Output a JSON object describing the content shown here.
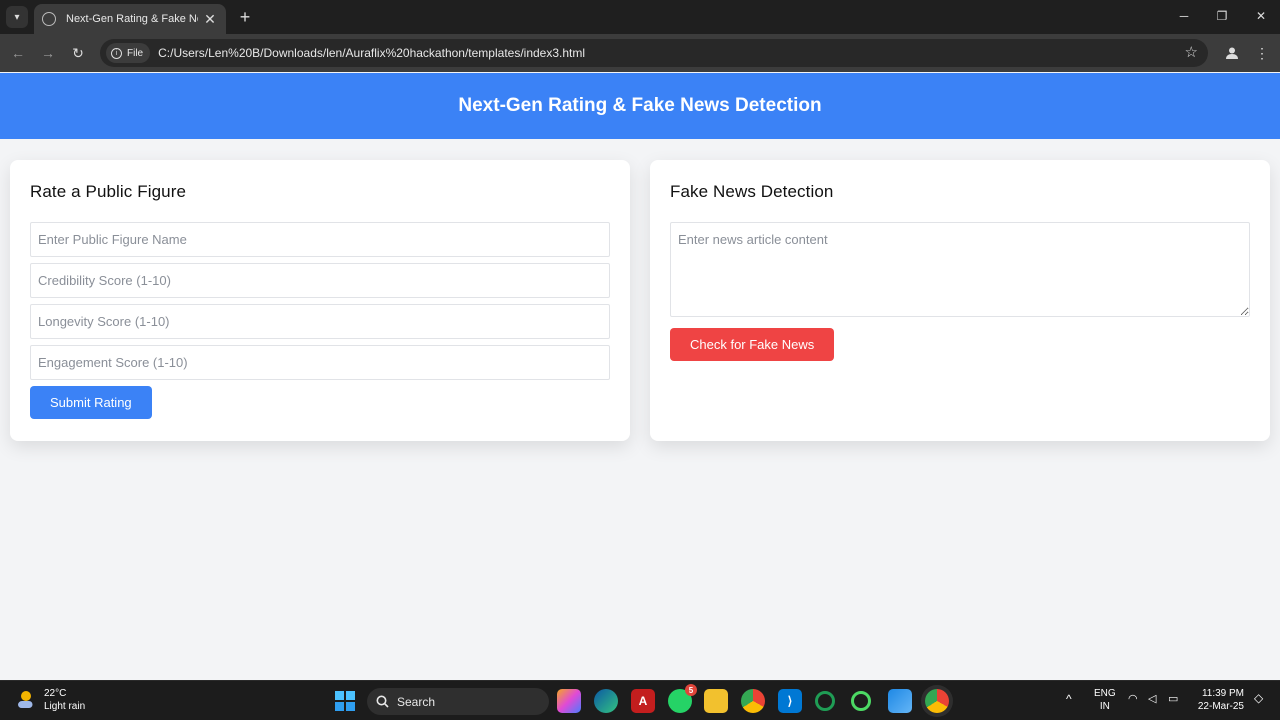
{
  "browser": {
    "tab_title": "Next-Gen Rating & Fake News Detection",
    "chip_label": "File",
    "url": "C:/Users/Len%20B/Downloads/len/Auraflix%20hackathon/templates/index3.html"
  },
  "header": {
    "title": "Next-Gen Rating & Fake News Detection"
  },
  "rating": {
    "heading": "Rate a Public Figure",
    "name_placeholder": "Enter Public Figure Name",
    "credibility_placeholder": "Credibility Score (1-10)",
    "longevity_placeholder": "Longevity Score (1-10)",
    "engagement_placeholder": "Engagement Score (1-10)",
    "submit_label": "Submit Rating"
  },
  "fake_news": {
    "heading": "Fake News Detection",
    "content_placeholder": "Enter news article content",
    "check_label": "Check for Fake News"
  },
  "taskbar": {
    "temperature": "22°C",
    "condition": "Light rain",
    "search_label": "Search",
    "whatsapp_badge": "5",
    "lang_top": "ENG",
    "lang_bottom": "IN",
    "time": "11:39 PM",
    "date": "22-Mar-25"
  },
  "colors": {
    "primary": "#3b82f6",
    "danger": "#ef4444",
    "page_bg": "#f3f4f6"
  }
}
